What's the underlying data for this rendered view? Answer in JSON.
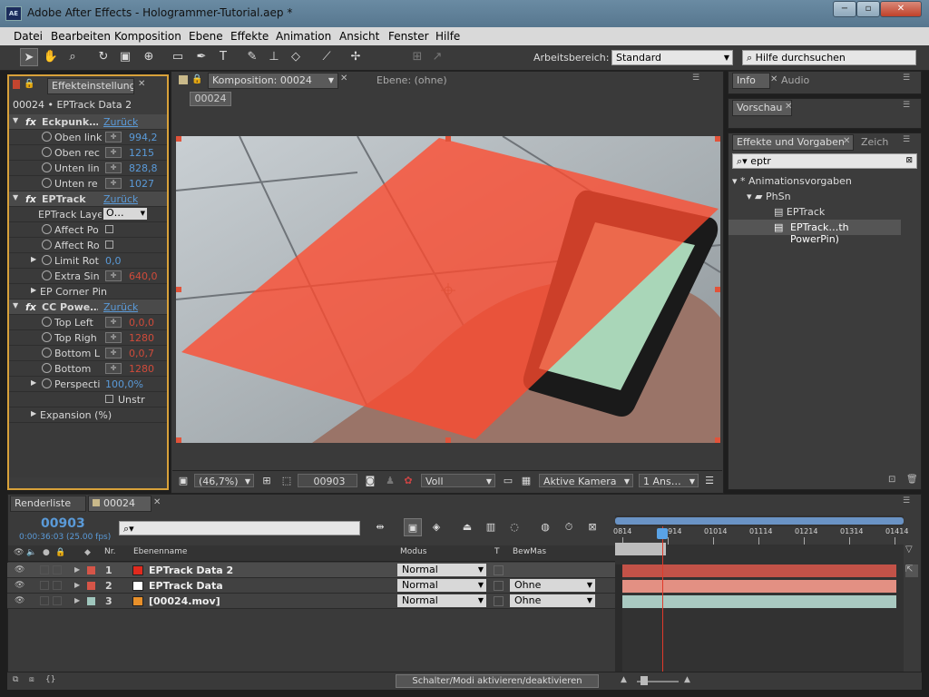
{
  "window": {
    "title": "Adobe After Effects - Hologrammer-Tutorial.aep *",
    "app_icon": "AE",
    "buttons": [
      "−",
      "▫",
      "✕"
    ]
  },
  "menu": [
    "Datei",
    "Bearbeiten",
    "Komposition",
    "Ebene",
    "Effekte",
    "Animation",
    "Ansicht",
    "Fenster",
    "Hilfe"
  ],
  "toolbar": {
    "workspace_label": "Arbeitsbereich:",
    "workspace_value": "Standard",
    "help_placeholder": "Hilfe durchsuchen"
  },
  "effects_panel": {
    "tab": "Effekteinstellung",
    "subtitle": "00024 • EPTrack Data 2",
    "rows": [
      {
        "type": "fx",
        "label": "Eckpunk…",
        "value": "Zurück"
      },
      {
        "type": "prop",
        "label": "Oben link",
        "value": "994,2"
      },
      {
        "type": "prop",
        "label": "Oben rec",
        "value": "1215"
      },
      {
        "type": "prop",
        "label": "Unten lin",
        "value": "828,8"
      },
      {
        "type": "prop",
        "label": "Unten re",
        "value": "1027"
      },
      {
        "type": "fx",
        "label": "EPTrack",
        "value": "Zurück"
      },
      {
        "type": "dropdown",
        "label": "EPTrack Laye",
        "value": "O…"
      },
      {
        "type": "check",
        "label": "Affect Po",
        "value": ""
      },
      {
        "type": "check",
        "label": "Affect Ro",
        "value": ""
      },
      {
        "type": "prop2",
        "label": "Limit Rot",
        "value": "0,0"
      },
      {
        "type": "prop",
        "label": "Extra Sin",
        "value": "640,0"
      },
      {
        "type": "group",
        "label": "EP Corner Pin",
        "value": ""
      },
      {
        "type": "fx",
        "label": "CC Powe…",
        "value": "Zurück"
      },
      {
        "type": "prop",
        "label": "Top Left",
        "value": "0,0,0"
      },
      {
        "type": "prop",
        "label": "Top Righ",
        "value": "1280"
      },
      {
        "type": "prop",
        "label": "Bottom L",
        "value": "0,0,7"
      },
      {
        "type": "prop",
        "label": "Bottom",
        "value": "1280"
      },
      {
        "type": "prop2",
        "label": "Perspecti",
        "value": "100,0%"
      },
      {
        "type": "check2",
        "label": "Unstr",
        "value": ""
      },
      {
        "type": "group",
        "label": "Expansion (%)",
        "value": ""
      }
    ]
  },
  "comp_panel": {
    "tab_comp": "Komposition: 00024",
    "tab_layer": "Ebene: (ohne)",
    "comp_chip": "00024",
    "footer": {
      "zoom": "(46,7%)",
      "timecode": "00903",
      "resolution": "Voll",
      "camera": "Aktive Kamera",
      "views": "1 Ans…"
    }
  },
  "right_panels": {
    "info_tab": "Info",
    "audio_tab": "Audio",
    "preview_tab": "Vorschau",
    "effects_tab": "Effekte und Vorgaben",
    "char_tab": "Zeich",
    "search_value": "eptr",
    "tree": [
      "* Animationsvorgaben",
      "PhSn",
      "EPTrack",
      "EPTrack…th PowerPin)"
    ]
  },
  "timeline": {
    "tab_render": "Renderliste",
    "tab_comp": "00024",
    "timecode": "00903",
    "timecode_sub": "0:00:36:03 (25.00 fps)",
    "headers": {
      "nr": "Nr.",
      "name": "Ebenenname",
      "mode": "Modus",
      "t": "T",
      "bewmas": "BewMas"
    },
    "layers": [
      {
        "nr": "1",
        "name": "EPTrack Data 2",
        "mode": "Normal",
        "bewmas": "",
        "color": "#d65548",
        "icon": "#e02a1e"
      },
      {
        "nr": "2",
        "name": "EPTrack Data",
        "mode": "Normal",
        "bewmas": "Ohne",
        "color": "#d65548",
        "icon": "#ffffff"
      },
      {
        "nr": "3",
        "name": "[00024.mov]",
        "mode": "Normal",
        "bewmas": "Ohne",
        "color": "#9fc6bd",
        "icon": "#e8902a"
      }
    ],
    "ruler": [
      "0814",
      "00914",
      "01014",
      "01114",
      "01214",
      "01314",
      "01414"
    ],
    "footer_button": "Schalter/Modi aktivieren/deaktivieren"
  },
  "colors": {
    "accent": "#5a9ad8",
    "layer_red": "#d65548",
    "layer_teal": "#9fc6bd",
    "playhead": "#e03a2a"
  }
}
